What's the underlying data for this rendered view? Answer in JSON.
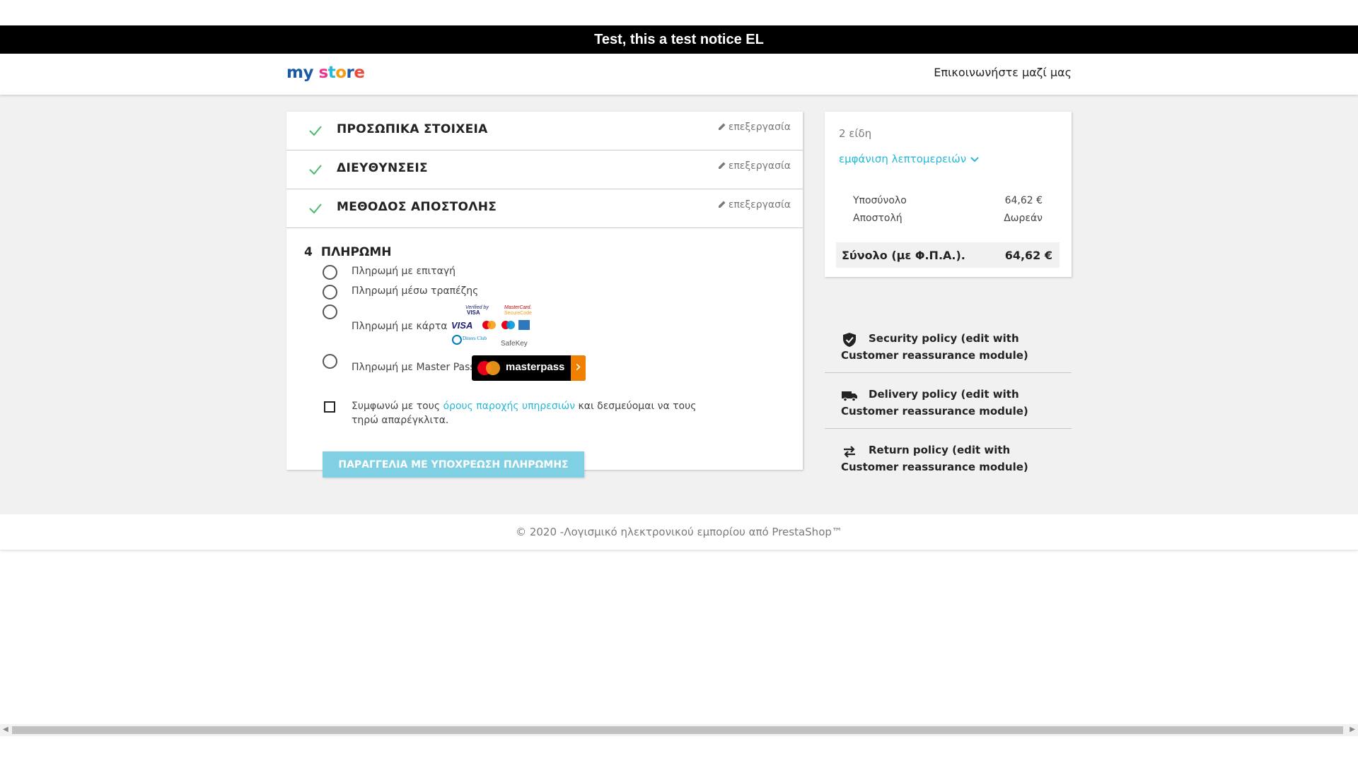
{
  "notice": "Test, this a test notice EL",
  "header": {
    "logo_my": "my",
    "logo_store": [
      "s",
      "t",
      "o",
      "r",
      "e"
    ],
    "contact": "Επικοινωνήστε μαζί μας"
  },
  "steps": [
    {
      "title": "ΠΡΟΣΩΠΙΚΑ ΣΤΟΙΧΕΙΑ",
      "edit": "επεξεργασία"
    },
    {
      "title": "ΔΙΕΥΘΥΝΣΕΙΣ",
      "edit": "επεξεργασία"
    },
    {
      "title": "ΜΕΘΟΔΟΣ ΑΠΟΣΤΟΛΗΣ",
      "edit": "επεξεργασία"
    }
  ],
  "payment": {
    "number": "4",
    "title": "ΠΛΗΡΩΜΗ",
    "options": [
      "Πληρωμή με επιταγή",
      "Πληρωμή μέσω τραπέζης",
      "Πληρωμή με κάρτα",
      "Πληρωμή με Master Pass"
    ],
    "card_logos": {
      "verified": "Verified by",
      "visa": "VISA",
      "mc_secure": "MasterCard.",
      "securecode": "SecureCode",
      "diners": "Diners Club",
      "safekey": "SafeKey"
    },
    "masterpass_label": "masterpass",
    "terms_before": "Συμφωνώ με τους ",
    "terms_link": "όρους παροχής υπηρεσιών",
    "terms_after": " και δεσμεύομαι να τους τηρώ απαρέγκλιτα.",
    "order_button": "ΠΑΡΑΓΓΕΛΙΑ ΜΕ ΥΠΟΧΡΕΩΣΗ ΠΛΗΡΩΜΗΣ"
  },
  "summary": {
    "items_count": "2 είδη",
    "show_details": "εμφάνιση λεπτομερειών",
    "subtotal_label": "Υποσύνολο",
    "subtotal_value": "64,62 €",
    "shipping_label": "Αποστολή",
    "shipping_value": "Δωρεάν",
    "total_label": "Σύνολο (με Φ.Π.Α.).",
    "total_value": "64,62 €"
  },
  "reassurance": [
    {
      "icon": "shield-check-icon",
      "text": "Security policy (edit with Customer reassurance module)"
    },
    {
      "icon": "truck-icon",
      "text": "Delivery policy (edit with Customer reassurance module)"
    },
    {
      "icon": "swap-arrows-icon",
      "text": "Return policy (edit with Customer reassurance module)"
    }
  ],
  "footer": "© 2020 -Λογισμικό ηλεκτρονικού εμπορίου από PrestaShop™",
  "colors": {
    "accent": "#25b9d7",
    "check_green": "#4cbb6c",
    "order_button_bg": "#7fd0e3"
  }
}
